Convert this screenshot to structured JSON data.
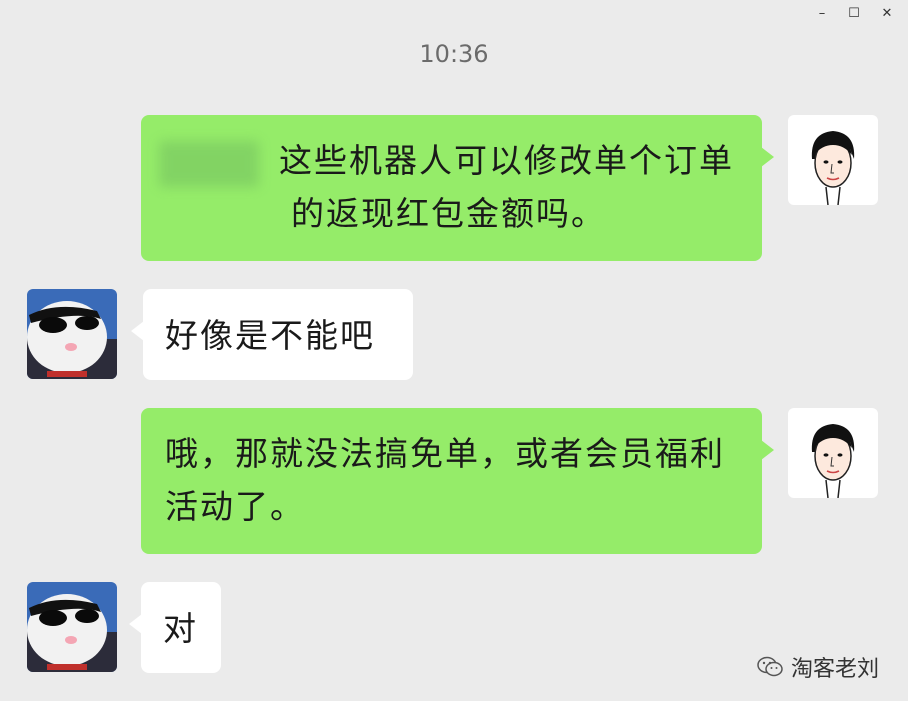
{
  "window": {
    "min_label": "–",
    "max_label": "☐",
    "close_label": "✕"
  },
  "chat": {
    "timestamp": "10:36",
    "messages": [
      {
        "sender": "me",
        "text": "这些机器人可以修改单个订单的返现红包金额吗。"
      },
      {
        "sender": "other",
        "text": "好像是不能吧"
      },
      {
        "sender": "me",
        "text": "哦，那就没法搞免单，或者会员福利活动了。"
      },
      {
        "sender": "other",
        "text": "对"
      }
    ]
  },
  "watermark": {
    "text": "淘客老刘",
    "icon": "wechat-icon"
  },
  "colors": {
    "background": "#ebebeb",
    "my_bubble": "#95ec69",
    "other_bubble": "#ffffff"
  }
}
